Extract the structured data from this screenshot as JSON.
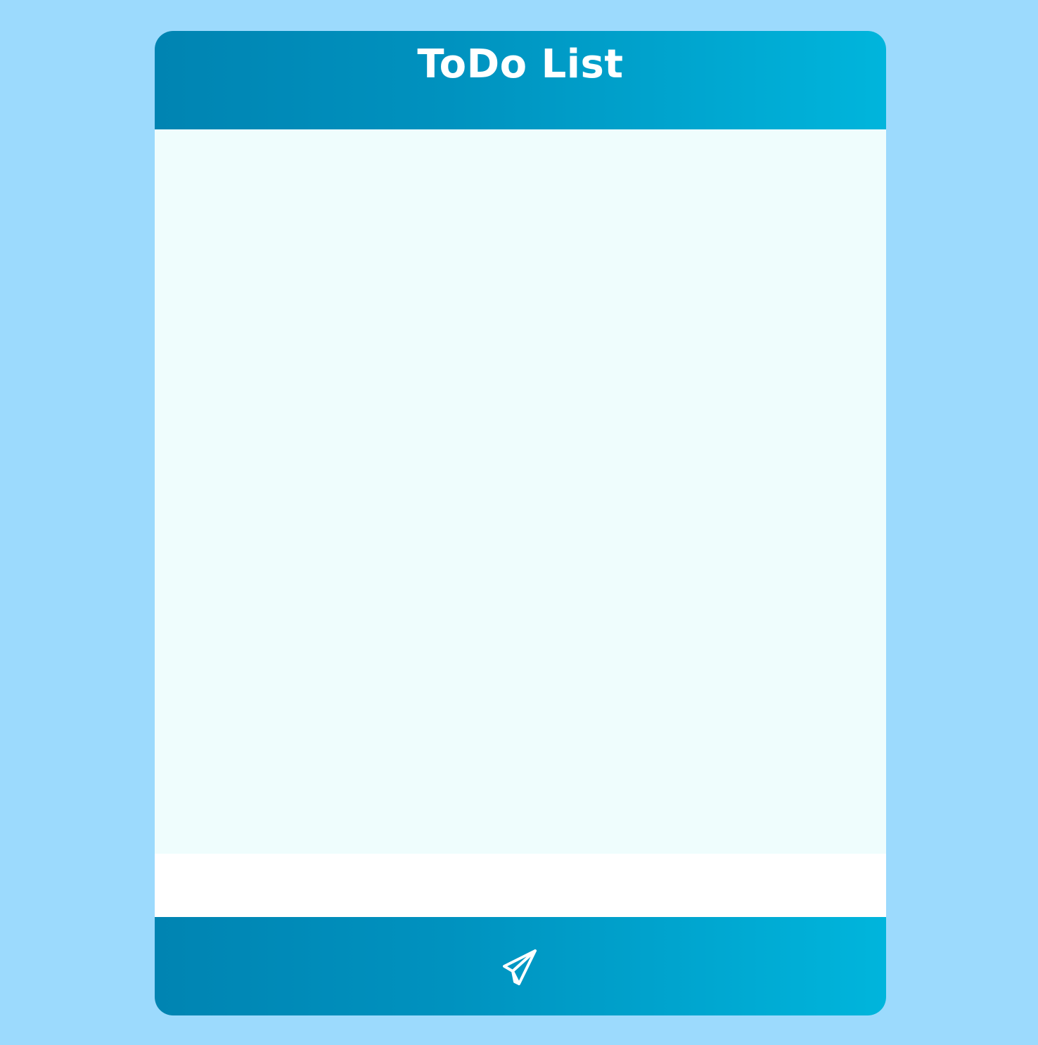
{
  "header": {
    "title": "ToDo List"
  },
  "todo_list": {
    "items": []
  },
  "input": {
    "value": "",
    "placeholder": ""
  },
  "footer": {
    "send_icon": "paper-plane-icon"
  },
  "colors": {
    "page_background": "#9cdafd",
    "header_gradient_start": "#0084b2",
    "header_gradient_end": "#00b5dc",
    "list_background": "#effdfd",
    "input_background": "#ffffff",
    "title_text": "#ffffff"
  }
}
